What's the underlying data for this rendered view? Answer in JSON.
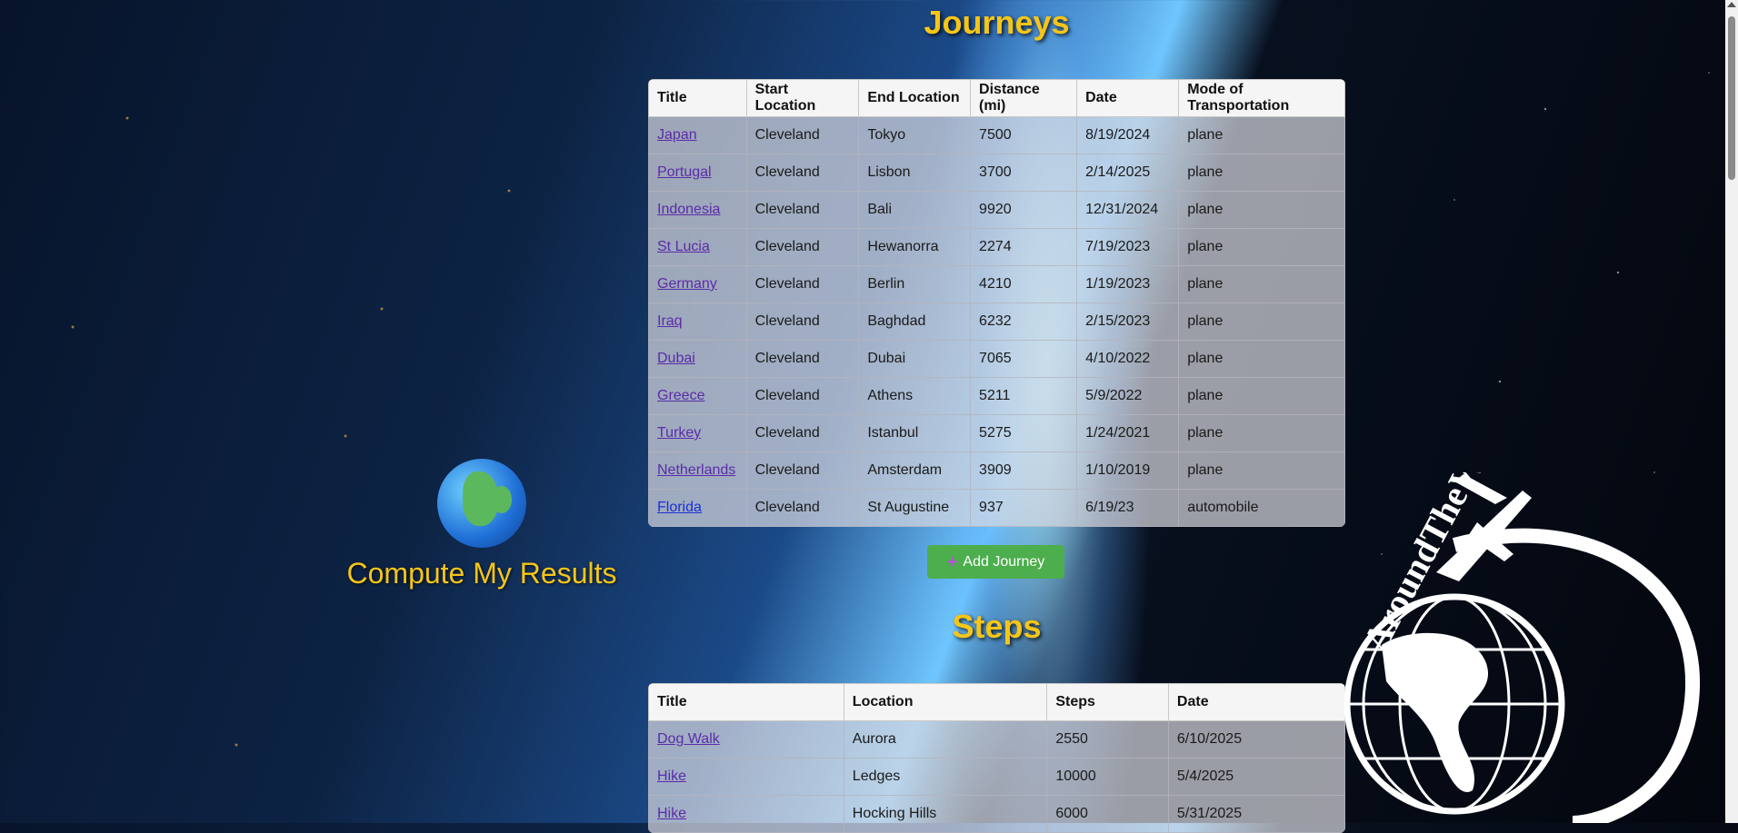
{
  "journeys": {
    "title": "Journeys",
    "columns": [
      "Title",
      "Start Location",
      "End Location",
      "Distance (mi)",
      "Date",
      "Mode of Transportation"
    ],
    "rows": [
      {
        "title": "Japan",
        "start": "Cleveland",
        "end": "Tokyo",
        "distance": "7500",
        "date": "8/19/2024",
        "mode": "plane"
      },
      {
        "title": "Portugal",
        "start": "Cleveland",
        "end": "Lisbon",
        "distance": "3700",
        "date": "2/14/2025",
        "mode": "plane"
      },
      {
        "title": "Indonesia",
        "start": "Cleveland",
        "end": "Bali",
        "distance": "9920",
        "date": "12/31/2024",
        "mode": "plane"
      },
      {
        "title": "St Lucia",
        "start": "Cleveland",
        "end": "Hewanorra",
        "distance": "2274",
        "date": "7/19/2023",
        "mode": "plane"
      },
      {
        "title": "Germany",
        "start": "Cleveland",
        "end": "Berlin",
        "distance": "4210",
        "date": "1/19/2023",
        "mode": "plane"
      },
      {
        "title": "Iraq",
        "start": "Cleveland",
        "end": "Baghdad",
        "distance": "6232",
        "date": "2/15/2023",
        "mode": "plane"
      },
      {
        "title": "Dubai",
        "start": "Cleveland",
        "end": "Dubai",
        "distance": "7065",
        "date": "4/10/2022",
        "mode": "plane"
      },
      {
        "title": "Greece",
        "start": "Cleveland",
        "end": "Athens",
        "distance": "5211",
        "date": "5/9/2022",
        "mode": "plane"
      },
      {
        "title": "Turkey",
        "start": "Cleveland",
        "end": "Istanbul",
        "distance": "5275",
        "date": "1/24/2021",
        "mode": "plane"
      },
      {
        "title": "Netherlands",
        "start": "Cleveland",
        "end": "Amsterdam",
        "distance": "3909",
        "date": "1/10/2019",
        "mode": "plane"
      },
      {
        "title": "Florida",
        "start": "Cleveland",
        "end": "St Augustine",
        "distance": "937",
        "date": "6/19/23",
        "mode": "automobile"
      }
    ],
    "add_label": "Add Journey",
    "add_icon": "plus-icon"
  },
  "steps": {
    "title": "Steps",
    "columns": [
      "Title",
      "Location",
      "Steps",
      "Date"
    ],
    "rows": [
      {
        "title": "Dog Walk",
        "location": "Aurora",
        "steps": "2550",
        "date": "6/10/2025"
      },
      {
        "title": "Hike",
        "location": "Ledges",
        "steps": "10000",
        "date": "5/4/2025"
      },
      {
        "title": "Hike",
        "location": "Hocking Hills",
        "steps": "6000",
        "date": "5/31/2025"
      }
    ]
  },
  "compute": {
    "label": "Compute My Results",
    "icon": "globe-icon"
  },
  "logo": {
    "text": "AroundTheWorld",
    "icon": "airplane-globe-logo"
  },
  "colors": {
    "title_yellow": "#f5c518",
    "button_green": "#4cae4c",
    "link_purple": "#5b2ba8"
  }
}
